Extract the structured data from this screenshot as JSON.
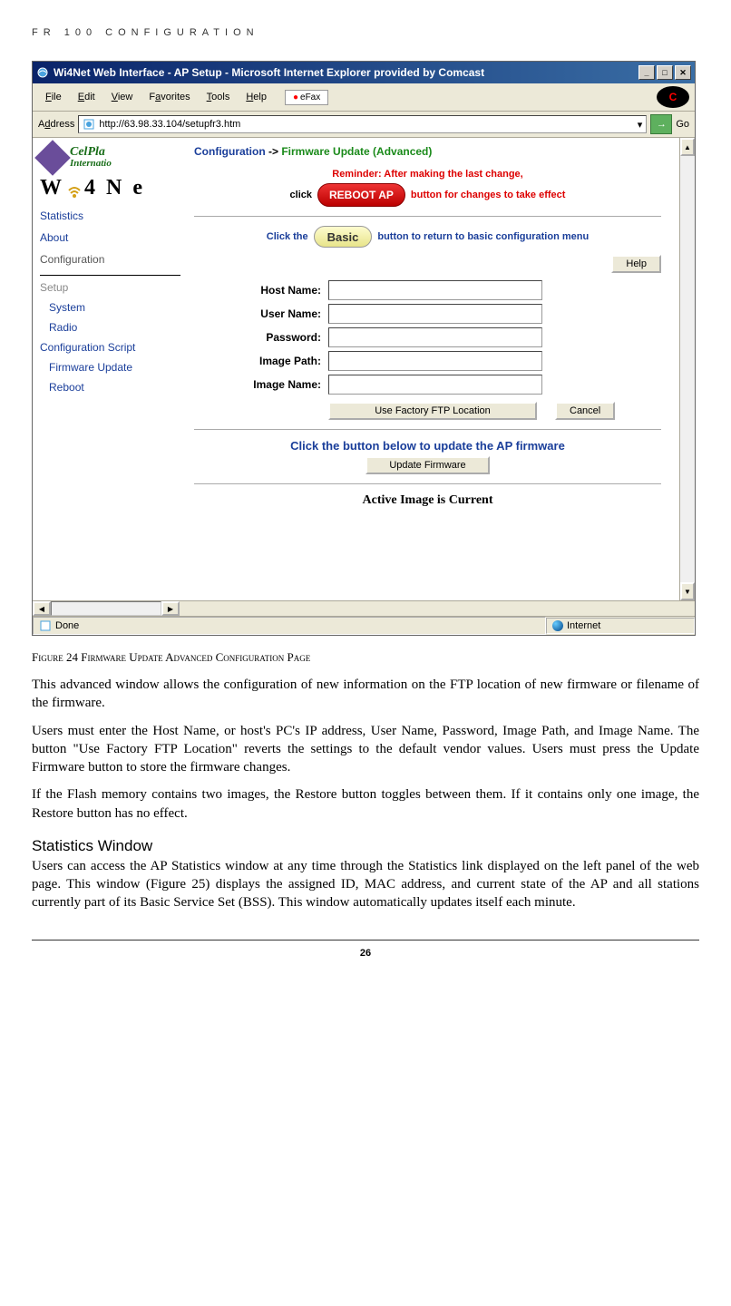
{
  "doc_header": "FR 100 CONFIGURATION",
  "browser": {
    "title": "Wi4Net Web Interface - AP Setup - Microsoft Internet Explorer provided by Comcast",
    "menus": [
      "File",
      "Edit",
      "View",
      "Favorites",
      "Tools",
      "Help"
    ],
    "efax": "eFax",
    "address_label": "Address",
    "url": "http://63.98.33.104/setupfr3.htm",
    "go": "Go"
  },
  "left_nav": {
    "brand1a": "CelPla",
    "brand1b": "Internatio",
    "brand2": "W i 4 N e",
    "links": [
      "Statistics",
      "About",
      "Configuration"
    ],
    "setup": "Setup",
    "subitems": [
      "System",
      "Radio",
      "Configuration Script",
      "Firmware Update",
      "Reboot"
    ]
  },
  "main": {
    "breadcrumb_a": "Configuration",
    "breadcrumb_sep": " -> ",
    "breadcrumb_b": "Firmware Update (Advanced)",
    "reminder": "Reminder: After making the last change,",
    "click_text": "click",
    "reboot_label": "REBOOT AP",
    "effect_text": "button for changes to take effect",
    "basic_pre": "Click the",
    "basic_label": "Basic",
    "basic_post": "button to return to basic configuration menu",
    "help": "Help",
    "fields": {
      "host": "Host Name:",
      "user": "User Name:",
      "pass": "Password:",
      "path": "Image Path:",
      "name": "Image Name:"
    },
    "factory_btn": "Use Factory FTP Location",
    "cancel_btn": "Cancel",
    "update_title": "Click the button below to update the AP firmware",
    "update_btn": "Update Firmware",
    "active": "Active Image is Current"
  },
  "status": {
    "done": "Done",
    "zone": "Internet"
  },
  "caption": "Figure 24 Firmware Update  Advanced Configuration Page",
  "para1": "This advanced window allows the configuration of new information on the FTP location of new firmware or filename of the firmware.",
  "para2": "Users must enter the Host Name, or host's PC's IP address, User Name, Password, Image Path, and Image Name. The button \"Use Factory FTP Location\" reverts the settings to the default vendor values. Users must press the Update Firmware button to store the firmware changes.",
  "para3": "If the Flash memory contains two images, the Restore button toggles between them. If it contains only one image, the Restore button has no effect.",
  "heading": "Statistics Window",
  "para4": "Users can access the AP Statistics window at any time through the Statistics link displayed on the left panel of the web page. This window (Figure 25) displays the assigned ID, MAC address, and current state of the AP and all stations currently part of its Basic Service Set (BSS). This window automatically updates itself each minute.",
  "page_number": "26"
}
